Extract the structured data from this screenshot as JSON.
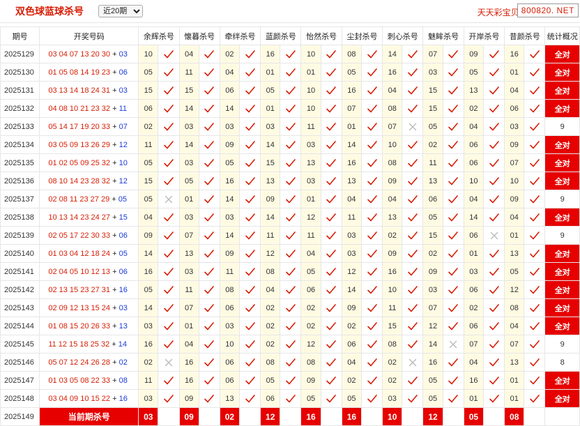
{
  "header": {
    "title": "双色球蓝球杀号",
    "period_selected": "近20期",
    "period_options": [
      "近20期"
    ],
    "brand": "天天彩宝贝,",
    "domain": "800820. NET"
  },
  "table": {
    "columns": [
      "期号",
      "开奖号码",
      "余辉杀号",
      "懐暮杀号",
      "牵绊杀号",
      "蓝颜杀号",
      "怡然杀号",
      "尘封杀号",
      "刺心杀号",
      "魅眸杀号",
      "开岸杀号",
      "昔颜杀号",
      "统计概况"
    ],
    "rows": [
      {
        "period": "2025129",
        "red": "03 04 07 13 20 30",
        "blue": "03",
        "kills": [
          [
            "10",
            true
          ],
          [
            "04",
            true
          ],
          [
            "02",
            true
          ],
          [
            "16",
            true
          ],
          [
            "10",
            true
          ],
          [
            "08",
            true
          ],
          [
            "14",
            true
          ],
          [
            "07",
            true
          ],
          [
            "09",
            true
          ],
          [
            "16",
            true
          ]
        ],
        "summary": "全对"
      },
      {
        "period": "2025130",
        "red": "01 05 08 14 19 23",
        "blue": "06",
        "kills": [
          [
            "05",
            true
          ],
          [
            "11",
            true
          ],
          [
            "04",
            true
          ],
          [
            "01",
            true
          ],
          [
            "01",
            true
          ],
          [
            "05",
            true
          ],
          [
            "16",
            true
          ],
          [
            "03",
            true
          ],
          [
            "05",
            true
          ],
          [
            "01",
            true
          ]
        ],
        "summary": "全对"
      },
      {
        "period": "2025131",
        "red": "03 13 14 18 24 31",
        "blue": "03",
        "kills": [
          [
            "15",
            true
          ],
          [
            "15",
            true
          ],
          [
            "06",
            true
          ],
          [
            "05",
            true
          ],
          [
            "10",
            true
          ],
          [
            "16",
            true
          ],
          [
            "04",
            true
          ],
          [
            "15",
            true
          ],
          [
            "13",
            true
          ],
          [
            "04",
            true
          ]
        ],
        "summary": "全对"
      },
      {
        "period": "2025132",
        "red": "04 08 10 21 23 32",
        "blue": "11",
        "kills": [
          [
            "06",
            true
          ],
          [
            "14",
            true
          ],
          [
            "14",
            true
          ],
          [
            "01",
            true
          ],
          [
            "10",
            true
          ],
          [
            "07",
            true
          ],
          [
            "08",
            true
          ],
          [
            "15",
            true
          ],
          [
            "02",
            true
          ],
          [
            "06",
            true
          ]
        ],
        "summary": "全对"
      },
      {
        "period": "2025133",
        "red": "05 14 17 19 20 33",
        "blue": "07",
        "kills": [
          [
            "02",
            true
          ],
          [
            "03",
            true
          ],
          [
            "03",
            true
          ],
          [
            "03",
            true
          ],
          [
            "11",
            true
          ],
          [
            "01",
            true
          ],
          [
            "07",
            false
          ],
          [
            "05",
            true
          ],
          [
            "04",
            true
          ],
          [
            "03",
            true
          ]
        ],
        "summary": "9"
      },
      {
        "period": "2025134",
        "red": "03 05 09 13 26 29",
        "blue": "12",
        "kills": [
          [
            "11",
            true
          ],
          [
            "14",
            true
          ],
          [
            "09",
            true
          ],
          [
            "14",
            true
          ],
          [
            "03",
            true
          ],
          [
            "14",
            true
          ],
          [
            "10",
            true
          ],
          [
            "02",
            true
          ],
          [
            "06",
            true
          ],
          [
            "09",
            true
          ]
        ],
        "summary": "全对"
      },
      {
        "period": "2025135",
        "red": "01 02 05 09 25 32",
        "blue": "10",
        "kills": [
          [
            "05",
            true
          ],
          [
            "03",
            true
          ],
          [
            "05",
            true
          ],
          [
            "15",
            true
          ],
          [
            "13",
            true
          ],
          [
            "16",
            true
          ],
          [
            "08",
            true
          ],
          [
            "11",
            true
          ],
          [
            "06",
            true
          ],
          [
            "07",
            true
          ]
        ],
        "summary": "全对"
      },
      {
        "period": "2025136",
        "red": "08 10 14 23 28 32",
        "blue": "12",
        "kills": [
          [
            "15",
            true
          ],
          [
            "05",
            true
          ],
          [
            "16",
            true
          ],
          [
            "13",
            true
          ],
          [
            "03",
            true
          ],
          [
            "13",
            true
          ],
          [
            "09",
            true
          ],
          [
            "13",
            true
          ],
          [
            "10",
            true
          ],
          [
            "10",
            true
          ]
        ],
        "summary": "全对"
      },
      {
        "period": "2025137",
        "red": "02 08 11 23 27 29",
        "blue": "05",
        "kills": [
          [
            "05",
            false
          ],
          [
            "01",
            true
          ],
          [
            "14",
            true
          ],
          [
            "09",
            true
          ],
          [
            "01",
            true
          ],
          [
            "04",
            true
          ],
          [
            "04",
            true
          ],
          [
            "06",
            true
          ],
          [
            "04",
            true
          ],
          [
            "09",
            true
          ]
        ],
        "summary": "9"
      },
      {
        "period": "2025138",
        "red": "10 13 14 23 24 27",
        "blue": "15",
        "kills": [
          [
            "04",
            true
          ],
          [
            "03",
            true
          ],
          [
            "03",
            true
          ],
          [
            "14",
            true
          ],
          [
            "12",
            true
          ],
          [
            "11",
            true
          ],
          [
            "13",
            true
          ],
          [
            "05",
            true
          ],
          [
            "14",
            true
          ],
          [
            "04",
            true
          ]
        ],
        "summary": "全对"
      },
      {
        "period": "2025139",
        "red": "02 05 17 22 30 33",
        "blue": "06",
        "kills": [
          [
            "09",
            true
          ],
          [
            "07",
            true
          ],
          [
            "14",
            true
          ],
          [
            "11",
            true
          ],
          [
            "11",
            true
          ],
          [
            "03",
            true
          ],
          [
            "02",
            true
          ],
          [
            "15",
            true
          ],
          [
            "06",
            false
          ],
          [
            "01",
            true
          ]
        ],
        "summary": "9"
      },
      {
        "period": "2025140",
        "red": "01 03 04 12 18 24",
        "blue": "05",
        "kills": [
          [
            "14",
            true
          ],
          [
            "13",
            true
          ],
          [
            "09",
            true
          ],
          [
            "12",
            true
          ],
          [
            "04",
            true
          ],
          [
            "03",
            true
          ],
          [
            "09",
            true
          ],
          [
            "02",
            true
          ],
          [
            "01",
            true
          ],
          [
            "13",
            true
          ]
        ],
        "summary": "全对"
      },
      {
        "period": "2025141",
        "red": "02 04 05 10 12 13",
        "blue": "06",
        "kills": [
          [
            "16",
            true
          ],
          [
            "03",
            true
          ],
          [
            "11",
            true
          ],
          [
            "08",
            true
          ],
          [
            "05",
            true
          ],
          [
            "12",
            true
          ],
          [
            "16",
            true
          ],
          [
            "09",
            true
          ],
          [
            "03",
            true
          ],
          [
            "05",
            true
          ]
        ],
        "summary": "全对"
      },
      {
        "period": "2025142",
        "red": "02 13 15 23 27 31",
        "blue": "16",
        "kills": [
          [
            "05",
            true
          ],
          [
            "11",
            true
          ],
          [
            "08",
            true
          ],
          [
            "04",
            true
          ],
          [
            "06",
            true
          ],
          [
            "14",
            true
          ],
          [
            "10",
            true
          ],
          [
            "03",
            true
          ],
          [
            "06",
            true
          ],
          [
            "12",
            true
          ]
        ],
        "summary": "全对"
      },
      {
        "period": "2025143",
        "red": "02 09 12 13 15 24",
        "blue": "03",
        "kills": [
          [
            "14",
            true
          ],
          [
            "07",
            true
          ],
          [
            "06",
            true
          ],
          [
            "02",
            true
          ],
          [
            "02",
            true
          ],
          [
            "09",
            true
          ],
          [
            "11",
            true
          ],
          [
            "07",
            true
          ],
          [
            "02",
            true
          ],
          [
            "08",
            true
          ]
        ],
        "summary": "全对"
      },
      {
        "period": "2025144",
        "red": "01 08 15 20 26 33",
        "blue": "13",
        "kills": [
          [
            "03",
            true
          ],
          [
            "01",
            true
          ],
          [
            "03",
            true
          ],
          [
            "02",
            true
          ],
          [
            "02",
            true
          ],
          [
            "02",
            true
          ],
          [
            "15",
            true
          ],
          [
            "12",
            true
          ],
          [
            "06",
            true
          ],
          [
            "04",
            true
          ]
        ],
        "summary": "全对"
      },
      {
        "period": "2025145",
        "red": "11 12 15 18 25 32",
        "blue": "14",
        "kills": [
          [
            "16",
            true
          ],
          [
            "04",
            true
          ],
          [
            "10",
            true
          ],
          [
            "02",
            true
          ],
          [
            "12",
            true
          ],
          [
            "06",
            true
          ],
          [
            "08",
            true
          ],
          [
            "14",
            false
          ],
          [
            "07",
            true
          ],
          [
            "07",
            true
          ]
        ],
        "summary": "9"
      },
      {
        "period": "2025146",
        "red": "05 07 12 24 26 28",
        "blue": "02",
        "kills": [
          [
            "02",
            false
          ],
          [
            "16",
            true
          ],
          [
            "06",
            true
          ],
          [
            "08",
            true
          ],
          [
            "08",
            true
          ],
          [
            "04",
            true
          ],
          [
            "02",
            false
          ],
          [
            "16",
            true
          ],
          [
            "04",
            true
          ],
          [
            "13",
            true
          ]
        ],
        "summary": "8"
      },
      {
        "period": "2025147",
        "red": "01 03 05 08 22 33",
        "blue": "08",
        "kills": [
          [
            "11",
            true
          ],
          [
            "16",
            true
          ],
          [
            "06",
            true
          ],
          [
            "05",
            true
          ],
          [
            "09",
            true
          ],
          [
            "02",
            true
          ],
          [
            "02",
            true
          ],
          [
            "05",
            true
          ],
          [
            "16",
            true
          ],
          [
            "01",
            true
          ]
        ],
        "summary": "全对"
      },
      {
        "period": "2025148",
        "red": "03 04 09 10 15 22",
        "blue": "16",
        "kills": [
          [
            "03",
            true
          ],
          [
            "09",
            true
          ],
          [
            "13",
            true
          ],
          [
            "06",
            true
          ],
          [
            "05",
            true
          ],
          [
            "05",
            true
          ],
          [
            "03",
            true
          ],
          [
            "05",
            true
          ],
          [
            "01",
            true
          ],
          [
            "01",
            true
          ]
        ],
        "summary": "全对"
      }
    ],
    "current": {
      "period": "2025149",
      "label": "当前期杀号",
      "kills": [
        "03",
        "09",
        "02",
        "12",
        "16",
        "16",
        "10",
        "12",
        "05",
        "08"
      ]
    }
  }
}
